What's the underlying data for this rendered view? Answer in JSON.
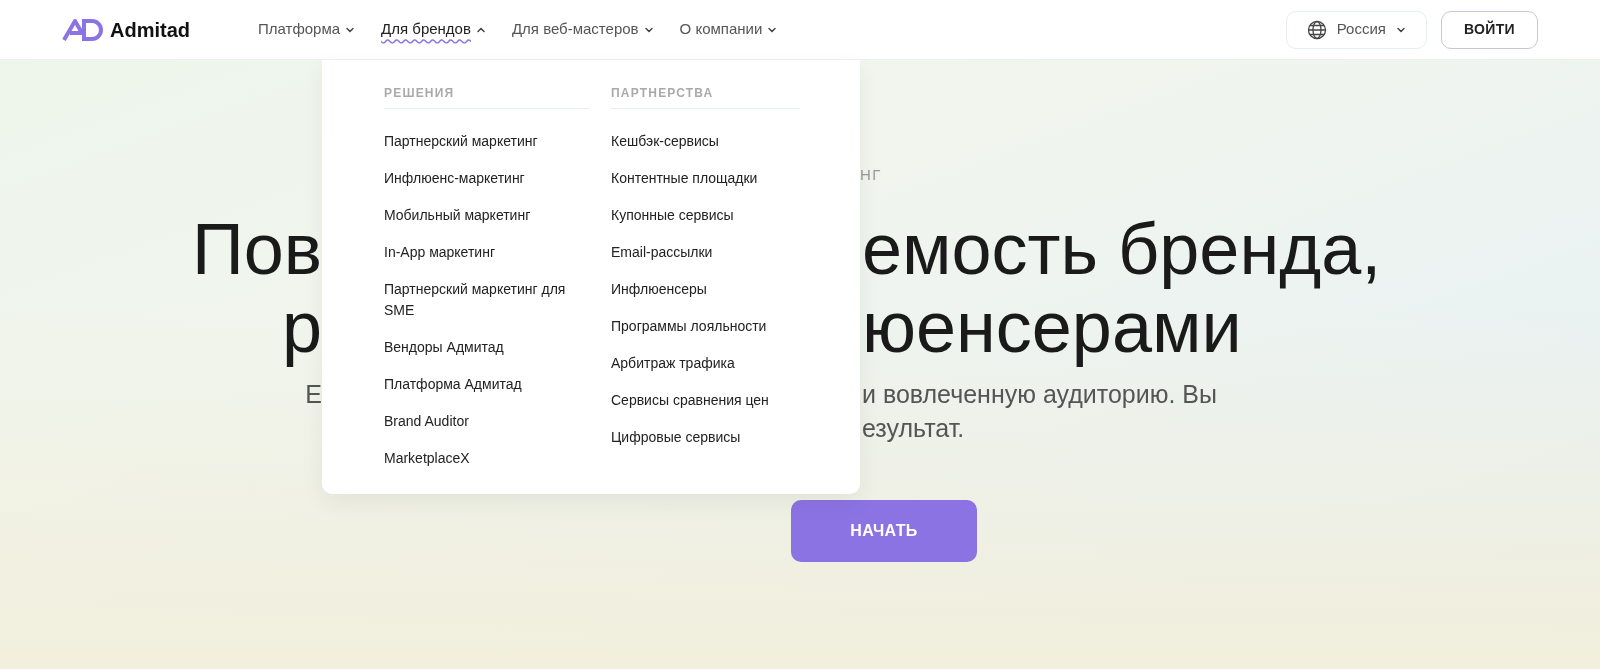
{
  "header": {
    "logo": "Admitad",
    "nav": [
      {
        "label": "Платформа",
        "expanded": false
      },
      {
        "label": "Для брендов",
        "expanded": true
      },
      {
        "label": "Для веб-мастеров",
        "expanded": false
      },
      {
        "label": "О компании",
        "expanded": false
      }
    ],
    "region": "Россия",
    "login": "ВОЙТИ"
  },
  "dropdown": {
    "columns": [
      {
        "heading": "РЕШЕНИЯ",
        "items": [
          "Партнерский маркетинг",
          "Инфлюенс-маркетинг",
          "Мобильный маркетинг",
          "In-App маркетинг",
          "Партнерский маркетинг для SME",
          "Вендоры Адмитад",
          "Платформа Адмитад",
          "Brand Auditor",
          "MarketplaceX"
        ]
      },
      {
        "heading": "ПАРТНЕРСТВА",
        "items": [
          "Кешбэк-сервисы",
          "Контентные площадки",
          "Купонные сервисы",
          "Email-рассылки",
          "Инфлюенсеры",
          "Программы лояльности",
          "Арбитраж трафика",
          "Сервисы сравнения цен",
          "Цифровые сервисы"
        ]
      }
    ]
  },
  "hero": {
    "eyebrow": {
      "right": "НГ"
    },
    "heading": [
      {
        "left": "Пов",
        "right": "емость бренда,"
      },
      {
        "left": "р",
        "right": "юенсерами"
      }
    ],
    "text": [
      {
        "left": "Е",
        "right": "и вовлеченную аудиторию. Вы"
      },
      {
        "right": "езультат."
      }
    ],
    "button": "НАЧАТЬ"
  }
}
